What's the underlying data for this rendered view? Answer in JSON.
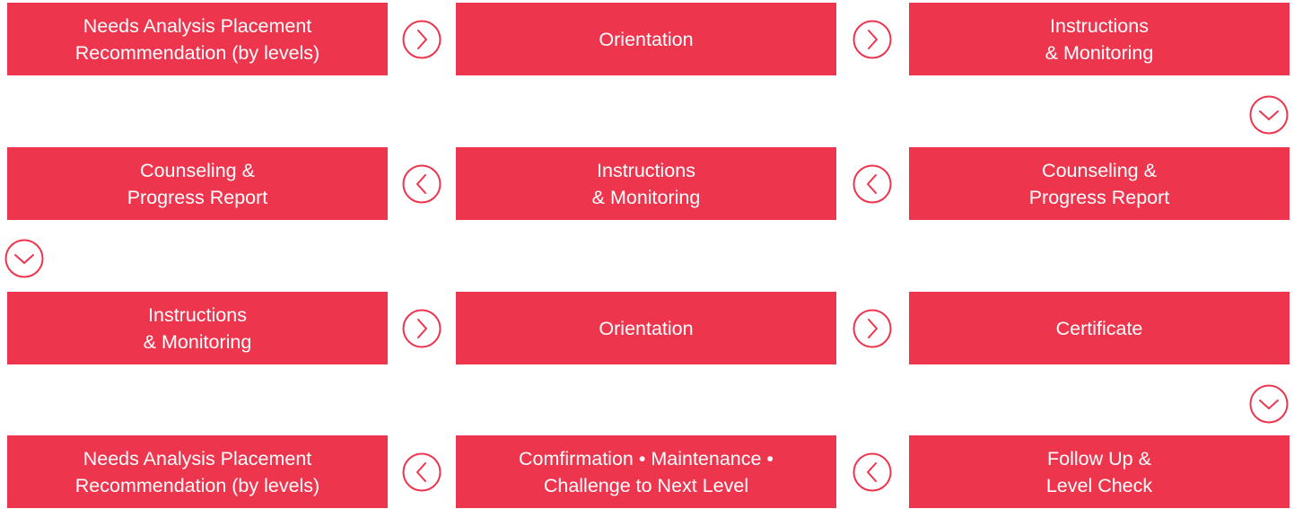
{
  "accent_color": "#ee354e",
  "rows": [
    {
      "boxes": [
        {
          "label": "Needs Analysis Placement\nRecommendation (by levels)"
        },
        {
          "label": "Orientation"
        },
        {
          "label": "Instructions\n& Monitoring"
        }
      ],
      "arrow_direction": "right"
    },
    {
      "boxes": [
        {
          "label": "Counseling &\nProgress Report"
        },
        {
          "label": "Instructions\n& Monitoring"
        },
        {
          "label": "Counseling &\nProgress Report"
        }
      ],
      "arrow_direction": "left"
    },
    {
      "boxes": [
        {
          "label": "Instructions\n& Monitoring"
        },
        {
          "label": "Orientation"
        },
        {
          "label": "Certificate"
        }
      ],
      "arrow_direction": "right"
    },
    {
      "boxes": [
        {
          "label": "Needs Analysis Placement\nRecommendation (by levels)"
        },
        {
          "label": "Comfirmation • Maintenance •\nChallenge to Next Level"
        },
        {
          "label": "Follow Up &\nLevel Check"
        }
      ],
      "arrow_direction": "left"
    }
  ],
  "icons": {
    "right": "chevron-right-circle-icon",
    "left": "chevron-left-circle-icon",
    "down": "chevron-down-circle-icon"
  }
}
